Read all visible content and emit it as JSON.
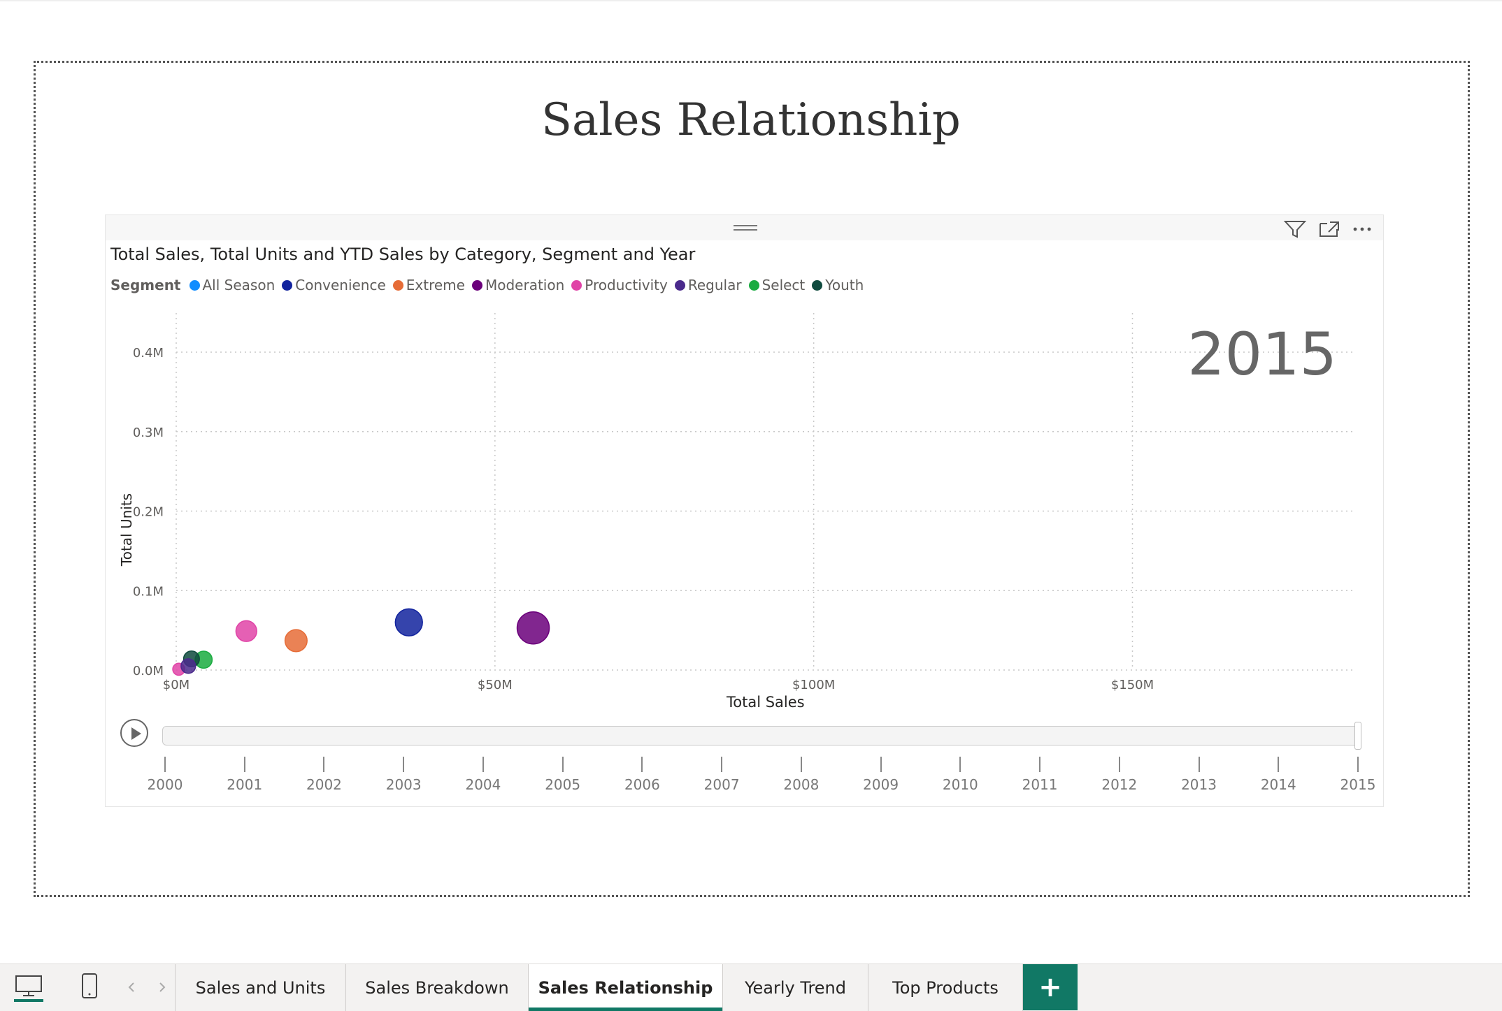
{
  "page": {
    "title": "Sales Relationship"
  },
  "visual": {
    "title": "Total Sales, Total Units and YTD Sales by Category, Segment and Year",
    "play_year": "2015",
    "legend": {
      "title": "Segment",
      "items": [
        {
          "label": "All Season",
          "color": "#118dff"
        },
        {
          "label": "Convenience",
          "color": "#12239e"
        },
        {
          "label": "Extreme",
          "color": "#e66c37"
        },
        {
          "label": "Moderation",
          "color": "#6b007b"
        },
        {
          "label": "Productivity",
          "color": "#e044a7"
        },
        {
          "label": "Regular",
          "color": "#4a2a8c"
        },
        {
          "label": "Select",
          "color": "#1aab40"
        },
        {
          "label": "Youth",
          "color": "#0f4a3e"
        }
      ]
    },
    "timeline": {
      "years": [
        "2000",
        "2001",
        "2002",
        "2003",
        "2004",
        "2005",
        "2006",
        "2007",
        "2008",
        "2009",
        "2010",
        "2011",
        "2012",
        "2013",
        "2014",
        "2015"
      ],
      "current": "2015"
    }
  },
  "chart_data": {
    "type": "scatter",
    "title": "Total Sales, Total Units and YTD Sales by Category, Segment and Year",
    "xlabel": "Total Sales",
    "ylabel": "Total Units",
    "xlim": [
      0,
      180000000
    ],
    "ylim": [
      0,
      0.4
    ],
    "x_ticks": [
      "$0M",
      "$50M",
      "$100M",
      "$150M"
    ],
    "y_ticks": [
      "0.0M",
      "0.1M",
      "0.2M",
      "0.3M",
      "0.4M"
    ],
    "grid": true,
    "legend_position": "top-left",
    "series": [
      {
        "name": "Moderation",
        "color": "#6b007b",
        "points": [
          {
            "x": 56000000,
            "y": 0.053,
            "size": 1.0
          }
        ]
      },
      {
        "name": "Convenience",
        "color": "#12239e",
        "points": [
          {
            "x": 36500000,
            "y": 0.06,
            "size": 0.8
          }
        ]
      },
      {
        "name": "Extreme",
        "color": "#e66c37",
        "points": [
          {
            "x": 18800000,
            "y": 0.037,
            "size": 0.6
          }
        ]
      },
      {
        "name": "Productivity",
        "color": "#e044a7",
        "points": [
          {
            "x": 11000000,
            "y": 0.049,
            "size": 0.55
          },
          {
            "x": 400000,
            "y": 0.001,
            "size": 0.2
          }
        ]
      },
      {
        "name": "Select",
        "color": "#1aab40",
        "points": [
          {
            "x": 4300000,
            "y": 0.013,
            "size": 0.4
          }
        ]
      },
      {
        "name": "Youth",
        "color": "#0f4a3e",
        "points": [
          {
            "x": 2400000,
            "y": 0.014,
            "size": 0.35
          }
        ]
      },
      {
        "name": "Regular",
        "color": "#4a2a8c",
        "points": [
          {
            "x": 1900000,
            "y": 0.005,
            "size": 0.3
          }
        ]
      }
    ]
  },
  "tabs": {
    "items": [
      {
        "label": "Sales and Units",
        "active": false
      },
      {
        "label": "Sales Breakdown",
        "active": false
      },
      {
        "label": "Sales Relationship",
        "active": true
      },
      {
        "label": "Yearly Trend",
        "active": false
      },
      {
        "label": "Top Products",
        "active": false
      }
    ],
    "add_label": "+"
  }
}
